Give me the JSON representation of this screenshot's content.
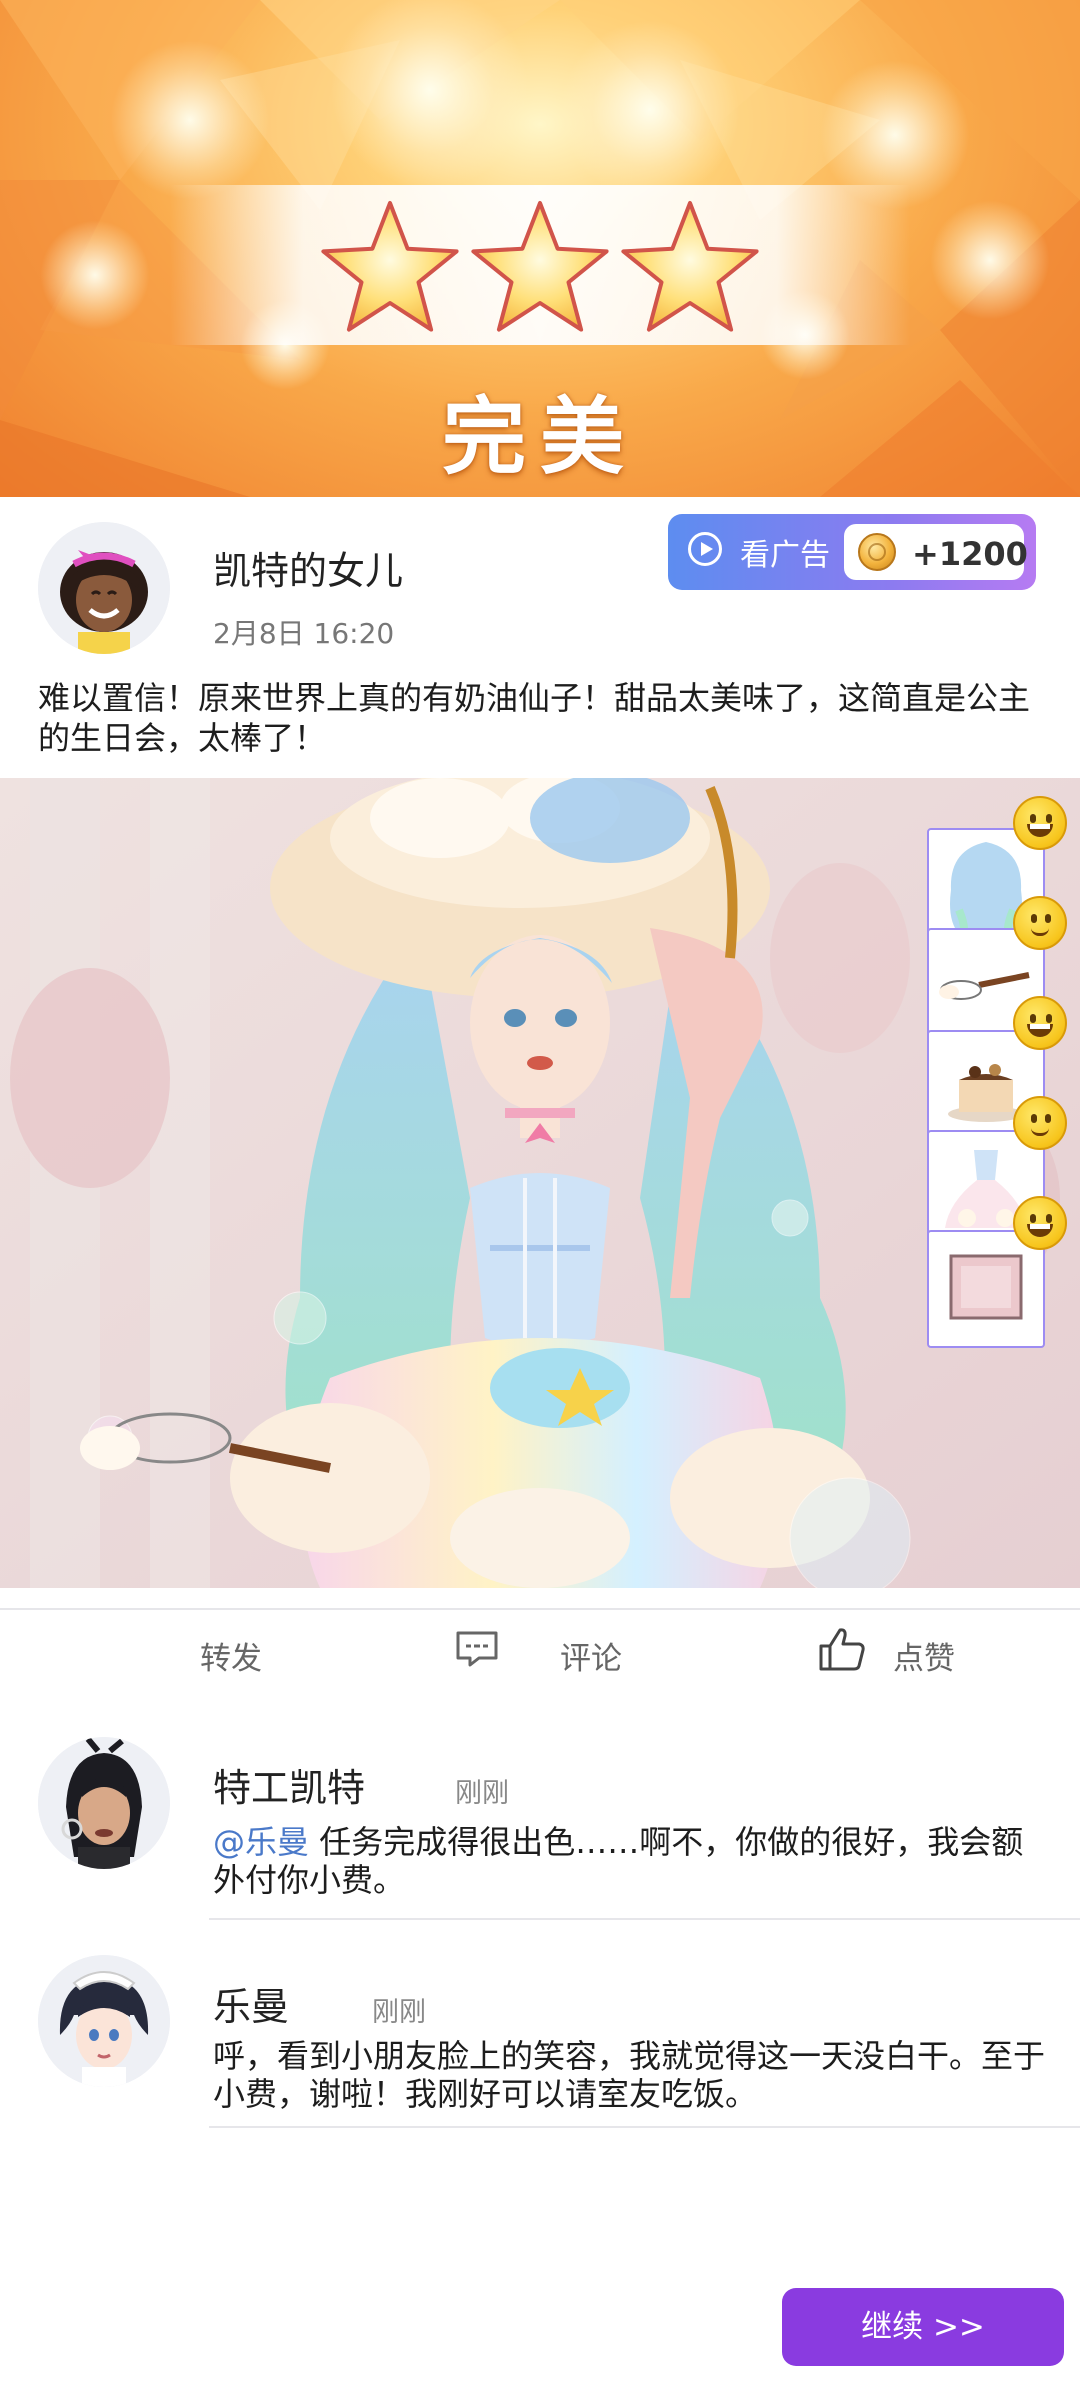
{
  "result": {
    "rating_stars": 3,
    "rating_max": 3,
    "title": "完美"
  },
  "post": {
    "author": "凯特的女儿",
    "time": "2月8日 16:20",
    "text": "难以置信！原来世界上真的有奶油仙子！甜品太美味了，这简直是公主的生日会，太棒了！",
    "ad_button": {
      "label": "看广告",
      "reward": "+1200"
    },
    "side_items": [
      {
        "icon": "hair-item-icon",
        "reaction": "grinning-emoji"
      },
      {
        "icon": "whisk-item-icon",
        "reaction": "smiling-emoji"
      },
      {
        "icon": "cake-item-icon",
        "reaction": "grinning-emoji"
      },
      {
        "icon": "dress-item-icon",
        "reaction": "smiling-emoji"
      },
      {
        "icon": "background-item-icon",
        "reaction": "grinning-emoji"
      }
    ]
  },
  "actions": {
    "share": "转发",
    "comment": "评论",
    "like": "点赞"
  },
  "comments": [
    {
      "name": "特工凯特",
      "time": "刚刚",
      "mention": "@乐曼",
      "text": " 任务完成得很出色……啊不，你做的很好，我会额外付你小费。"
    },
    {
      "name": "乐曼",
      "time": "刚刚",
      "mention": "",
      "text": "呼，看到小朋友脸上的笑容，我就觉得这一天没白干。至于小费，谢啦！我刚好可以请室友吃饭。"
    }
  ],
  "continue_button": "继续 >>",
  "colors": {
    "accent_purple": "#8a3be0",
    "mention_blue": "#4a79c9",
    "banner_orange": "#f9a94a"
  }
}
